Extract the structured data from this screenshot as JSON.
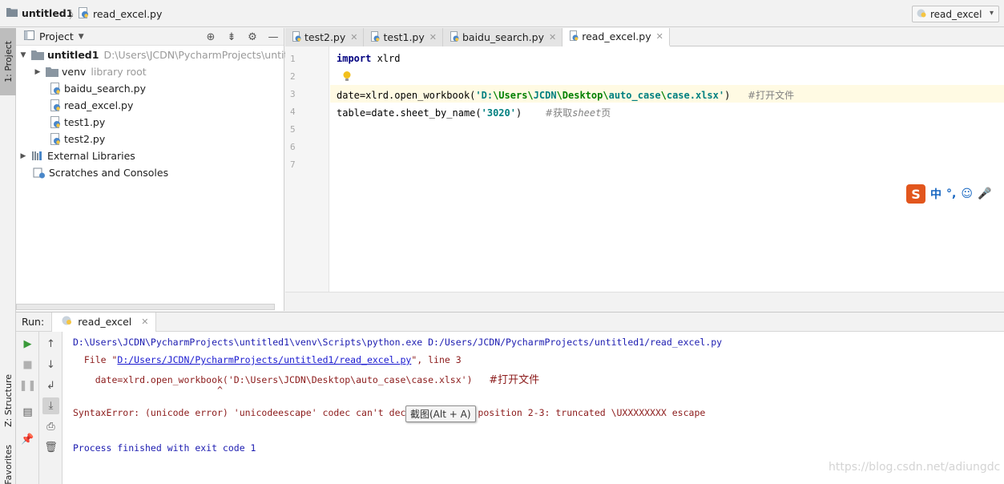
{
  "navbar": {
    "project": "untitled1",
    "file": "read_excel.py",
    "run_config": "read_excel"
  },
  "tool_windows": {
    "project_tab": "1: Project",
    "structure_tab": "Z: Structure",
    "favorites_tab": "Favorites"
  },
  "project_panel": {
    "title": "Project",
    "tree": [
      {
        "label": "untitled1",
        "hint": "D:\\Users\\JCDN\\PycharmProjects\\untitled"
      },
      {
        "label": "venv",
        "hint": "library root"
      },
      {
        "label": "baidu_search.py"
      },
      {
        "label": "read_excel.py"
      },
      {
        "label": "test1.py"
      },
      {
        "label": "test2.py"
      },
      {
        "label": "External Libraries"
      },
      {
        "label": "Scratches and Consoles"
      }
    ]
  },
  "editor": {
    "tabs": [
      "test2.py",
      "test1.py",
      "baidu_search.py",
      "read_excel.py"
    ],
    "active_tab": "read_excel.py",
    "line_numbers": [
      "1",
      "2",
      "3",
      "4",
      "5",
      "6",
      "7"
    ],
    "caret_line": "3",
    "code": {
      "l1_kw": "import",
      "l1_rest": " xlrd",
      "l3_pre": "date=xlrd.open_workbook(",
      "l3_s1": "'D:",
      "l3_s2": "\\Users\\",
      "l3_s3": "JCDN",
      "l3_s4": "\\Desktop\\",
      "l3_s5": "a",
      "l3_s6": "uto_case",
      "l3_s7": "\\",
      "l3_s8": "case.xlsx'",
      "l3_post": ")   ",
      "l3_comment": "#打开文件",
      "l4_pre": "table=date.sheet_by_name(",
      "l4_str": "'3020'",
      "l4_post": ")    ",
      "l4_comment_a": "#获取",
      "l4_comment_b": "sheet",
      "l4_comment_c": "页"
    }
  },
  "ime_bar": {
    "logo": "S",
    "items": [
      "中",
      "°,",
      "☺",
      "🎤"
    ]
  },
  "run_panel": {
    "label": "Run:",
    "tab": "read_excel",
    "console": {
      "line1": "D:\\Users\\JCDN\\PycharmProjects\\untitled1\\venv\\Scripts\\python.exe D:/Users/JCDN/PycharmProjects/untitled1/read_excel.py",
      "line2_pre": "  File \"",
      "line2_link": "D:/Users/JCDN/PycharmProjects/untitled1/read_excel.py",
      "line2_post": "\", line 3",
      "line3_code": "    date=xlrd.open_workbook('D:\\Users\\JCDN\\Desktop\\auto_case\\case.xlsx')   ",
      "line3_comment": "#打开文件",
      "line4": "                          ^",
      "line5": "SyntaxError: (unicode error) 'unicodeescape' codec can't decode bytes in position 2-3: truncated \\UXXXXXXXX escape",
      "line6": "Process finished with exit code 1"
    }
  },
  "tooltip": "截图(Alt + A)",
  "watermark": "https://blog.csdn.net/adiungdc"
}
